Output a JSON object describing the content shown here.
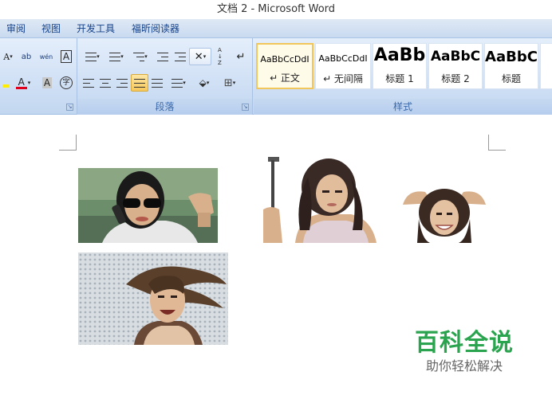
{
  "window": {
    "title": "文档 2 - Microsoft Word"
  },
  "menu_tabs": [
    "审阅",
    "视图",
    "开发工具",
    "福昕阅读器"
  ],
  "ribbon": {
    "font_group": {
      "grow_font_glyph": "A",
      "change_case_glyph": "ab",
      "phonetic_glyph": "wén",
      "char_border_glyph": "A",
      "font_color_glyph": "A",
      "char_shading_glyph": "A",
      "enclose_glyph": "字"
    },
    "paragraph_group": {
      "label": "段落",
      "sort_glyph": "A↓Z"
    },
    "styles_group": {
      "label": "样式",
      "items": [
        {
          "sample": "AaBbCcDdI",
          "name": "↵ 正文",
          "selected": true
        },
        {
          "sample": "AaBbCcDdI",
          "name": "↵ 无间隔",
          "selected": false
        },
        {
          "sample": "AaBb",
          "name": "标题 1",
          "selected": false
        },
        {
          "sample": "AaBbC",
          "name": "标题 2",
          "selected": false
        },
        {
          "sample": "AaBbC",
          "name": "标题",
          "selected": false
        }
      ]
    }
  },
  "watermark": {
    "main": "百科全说",
    "sub": "助你轻松解决"
  },
  "colors": {
    "accent_text": "#15428b",
    "font_color_red": "#e0001b",
    "watermark_green": "#2aa44e"
  }
}
